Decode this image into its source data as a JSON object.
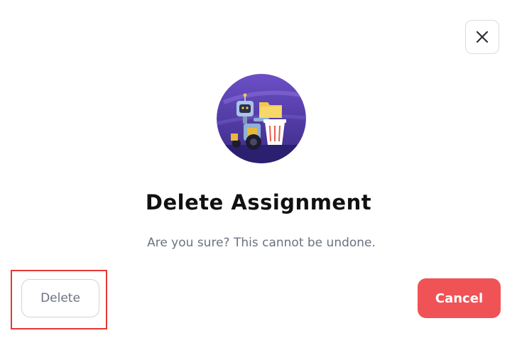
{
  "dialog": {
    "title": "Delete Assignment",
    "message": "Are you sure? This cannot be undone.",
    "close_icon": "close-icon",
    "illustration_icon": "robot-trash-illustration"
  },
  "actions": {
    "delete_label": "Delete",
    "cancel_label": "Cancel"
  },
  "colors": {
    "cancel_bg": "#f05356",
    "highlight": "#e53935",
    "illustration_bg": "#5b3fa8"
  }
}
